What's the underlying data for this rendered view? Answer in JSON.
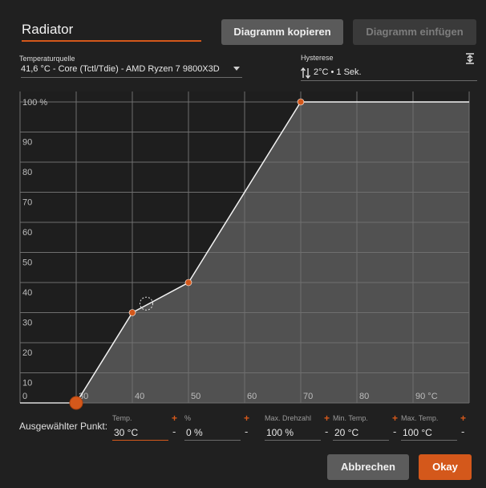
{
  "curve_name": "Radiator",
  "buttons": {
    "copy": "Diagramm kopieren",
    "paste": "Diagramm einfügen",
    "cancel": "Abbrechen",
    "ok": "Okay"
  },
  "source": {
    "label": "Temperaturquelle",
    "value": "41,6 °C - Core (Tctl/Tdie) - AMD Ryzen 7 9800X3D"
  },
  "hysteresis": {
    "label": "Hysterese",
    "value": "2°C • 1 Sek."
  },
  "selected_point": {
    "row_label": "Ausgewählter Punkt:",
    "fields": [
      {
        "label": "Temp.",
        "value": "30 °C"
      },
      {
        "label": "%",
        "value": "0 %"
      },
      {
        "label": "Max. Drehzahl",
        "value": "100 %"
      },
      {
        "label": "Min. Temp.",
        "value": "20 °C"
      },
      {
        "label": "Max. Temp.",
        "value": "100 °C"
      }
    ],
    "plus": "+",
    "minus": "-"
  },
  "colors": {
    "accent": "#d4581b",
    "plot_bg": "#1e1e1e",
    "fill": "#5a5a5a",
    "grid": "#6f6f6f"
  },
  "chart_data": {
    "type": "area",
    "x": [
      30,
      40,
      50,
      70,
      100
    ],
    "y": [
      0,
      30,
      40,
      100,
      100
    ],
    "selected_index": 0,
    "hover_point": {
      "x": 42.5,
      "y": 33
    },
    "xlim": [
      20,
      100
    ],
    "ylim": [
      0,
      100
    ],
    "x_ticks": [
      "0",
      "30",
      "40",
      "50",
      "60",
      "70",
      "80",
      "90 °C"
    ],
    "y_ticks": [
      "100 %",
      "90",
      "80",
      "70",
      "60",
      "50",
      "40",
      "30",
      "20",
      "10"
    ],
    "grid": true
  }
}
